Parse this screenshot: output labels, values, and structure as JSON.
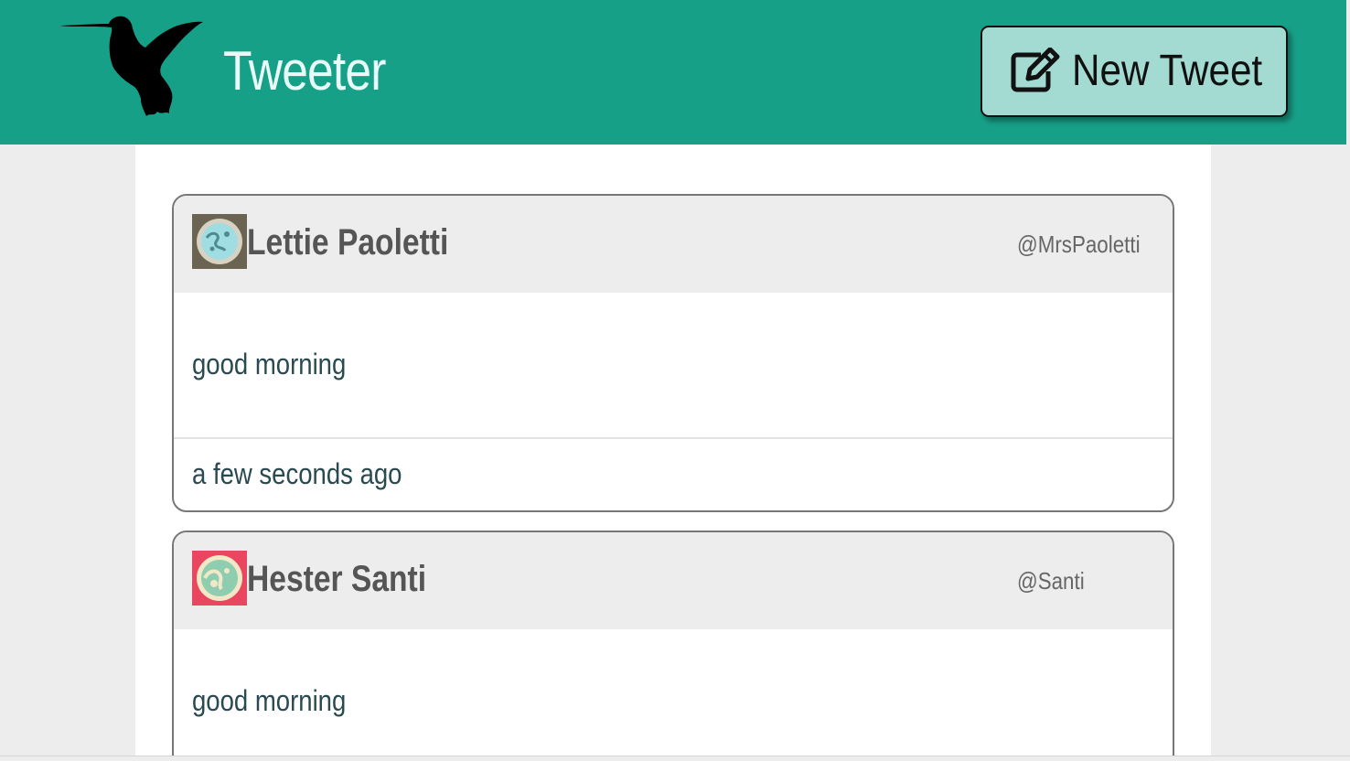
{
  "header": {
    "app_title": "Tweeter",
    "logo_icon": "hummingbird-icon",
    "new_tweet_label": "New Tweet",
    "new_tweet_icon": "edit-icon",
    "accent_color": "#17a088",
    "button_color": "#a3dbd2"
  },
  "tweets": [
    {
      "name": "Lettie Paoletti",
      "handle": "@MrsPaoletti",
      "text": "good morning",
      "time": "a few seconds ago",
      "avatar_icon": "avatar-icon",
      "avatar_bg": "#6b6453"
    },
    {
      "name": "Hester Santi",
      "handle": "@Santi",
      "text": "good morning",
      "avatar_icon": "avatar-icon",
      "avatar_bg": "#e8475f"
    }
  ]
}
